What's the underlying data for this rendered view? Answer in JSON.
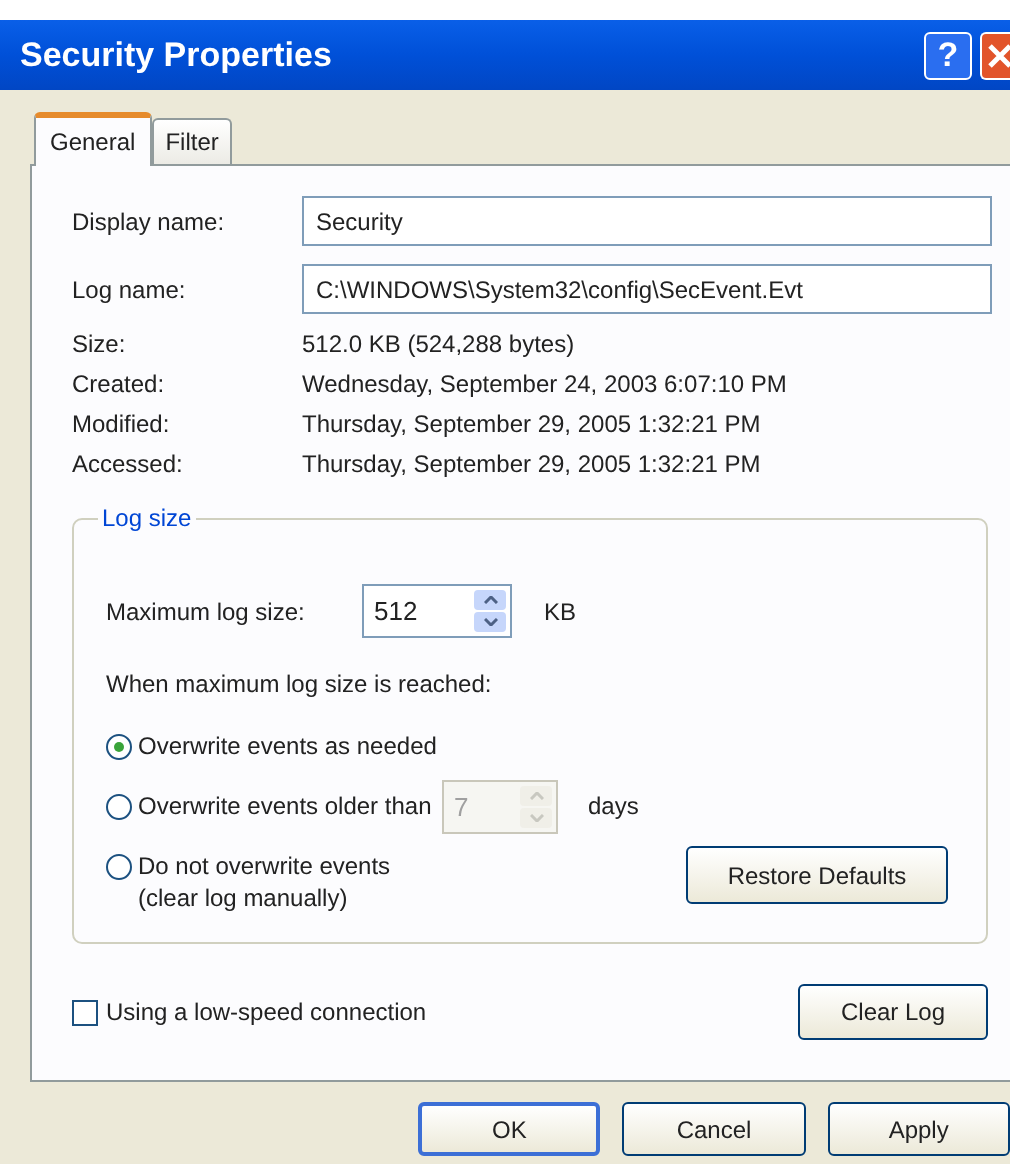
{
  "window": {
    "title": "Security Properties",
    "help_button": "?"
  },
  "tabs": [
    {
      "label": "General",
      "selected": true
    },
    {
      "label": "Filter",
      "selected": false
    }
  ],
  "fields": [
    {
      "label": "Display name:",
      "value": "Security"
    },
    {
      "label": "Log name:",
      "value": "C:\\WINDOWS\\System32\\config\\SecEvent.Evt"
    }
  ],
  "info": [
    {
      "label": "Size:",
      "value": "512.0 KB (524,288 bytes)"
    },
    {
      "label": "Created:",
      "value": "Wednesday, September 24, 2003 6:07:10 PM"
    },
    {
      "label": "Modified:",
      "value": "Thursday, September 29, 2005 1:32:21 PM"
    },
    {
      "label": "Accessed:",
      "value": "Thursday, September 29, 2005 1:32:21 PM"
    }
  ],
  "log_size": {
    "title": "Log size",
    "max_label": "Maximum log size:",
    "max_value": "512",
    "max_unit": "KB",
    "prompt": "When maximum log size is reached:",
    "options": [
      {
        "label": "Overwrite events as needed",
        "selected": true
      },
      {
        "label": "Overwrite events older than",
        "selected": false,
        "days": {
          "value": "7",
          "disabled": true,
          "unit": "days"
        }
      },
      {
        "label": "Do not overwrite events",
        "note": "(clear log manually)",
        "selected": false
      }
    ],
    "restore_button": "Restore Defaults"
  },
  "low_speed": {
    "label": "Using a low-speed connection",
    "checked": false
  },
  "clear_button": "Clear Log",
  "buttons": [
    {
      "label": "OK",
      "default": true
    },
    {
      "label": "Cancel",
      "default": false
    },
    {
      "label": "Apply",
      "default": false
    }
  ]
}
